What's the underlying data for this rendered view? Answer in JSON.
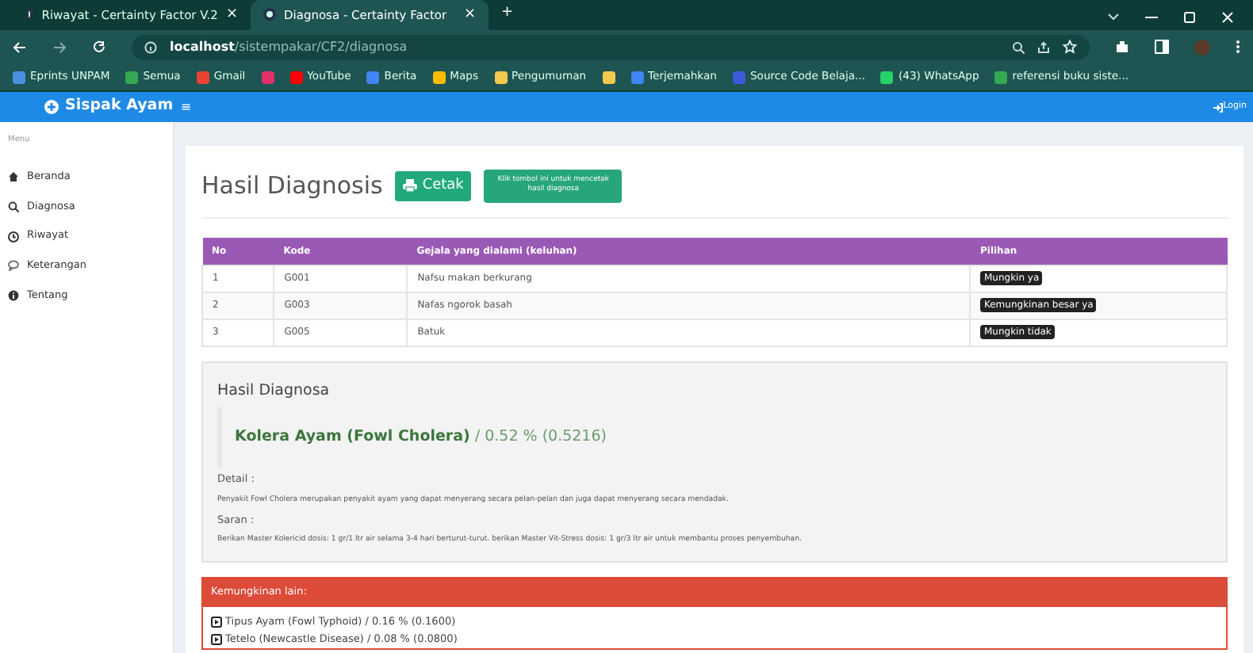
{
  "browser": {
    "tabs": [
      {
        "title": "Riwayat - Certainty Factor V.2",
        "close": "×",
        "selected": false
      },
      {
        "title": "Diagnosa - Certainty Factor",
        "close": "×",
        "selected": true
      }
    ],
    "new_tab": "+",
    "address": {
      "host": "localhost",
      "path": "/sistempakar/CF2/diagnosa"
    },
    "bookmarks": [
      {
        "label": "Eprints UNPAM",
        "color": "#4a90e2"
      },
      {
        "label": "Semua",
        "color": "#34a853"
      },
      {
        "label": "Gmail",
        "color": "#ea4335"
      },
      {
        "color": "#e1306c"
      },
      {
        "label": "YouTube",
        "color": "#ff0000"
      },
      {
        "label": "Berita",
        "color": "#4285f4"
      },
      {
        "label": "Maps",
        "color": "#fbbc04"
      },
      {
        "label": "Pengumuman",
        "color": "#f2c94c"
      },
      {
        "color": "#f2c94c"
      },
      {
        "label": "Terjemahkan",
        "color": "#4285f4"
      },
      {
        "label": "Source Code Belaja...",
        "color": "#3b5bdb"
      },
      {
        "label": "(43) WhatsApp",
        "color": "#25d366"
      },
      {
        "label": "referensi buku siste...",
        "color": "#34a853"
      }
    ]
  },
  "app": {
    "brand": "Sispak Ayam",
    "menu_button": "≡",
    "login": "Login"
  },
  "sidebar": {
    "menu_label": "Menu",
    "items": [
      {
        "label": "Beranda",
        "kind": "home"
      },
      {
        "label": "Diagnosa",
        "kind": "search"
      },
      {
        "label": "Riwayat",
        "kind": "clock"
      },
      {
        "label": "Keterangan",
        "kind": "chat"
      },
      {
        "label": "Tentang",
        "kind": "info"
      }
    ]
  },
  "page": {
    "title": "Hasil Diagnosis",
    "print_button": "Cetak",
    "tooltip": "Klik tombol ini untuk mencetak hasil diagnosa"
  },
  "table": {
    "columns": [
      "No",
      "Kode",
      "Gejala yang dialami (keluhan)",
      "Pilihan"
    ],
    "rows": [
      [
        "1",
        "G001",
        "Nafsu makan berkurang",
        "Mungkin ya"
      ],
      [
        "2",
        "G003",
        "Nafas ngorok basah",
        "Kemungkinan besar ya"
      ],
      [
        "3",
        "G005",
        "Batuk",
        "Mungkin tidak"
      ]
    ]
  },
  "result": {
    "heading": "Hasil Diagnosa",
    "disease": "Kolera Ayam (Fowl Cholera)",
    "score": " / 0.52 % (0.5216)",
    "detail_label": "Detail :",
    "detail": "Penyakit Fowl Cholera merupakan penyakit ayam yang dapat menyerang secara pelan-pelan dan juga dapat menyerang secara mendadak.",
    "advice_label": "Saran :",
    "advice": "Berikan Master Kolericid dosis: 1 gr/1 ltr air selama 3-4 hari berturut-turut. berikan Master Vit-Stress dosis: 1 gr/3 ltr air untuk membantu proses penyembuhan."
  },
  "others": {
    "header": "Kemungkinan lain:",
    "items": [
      "Tipus Ayam (Fowl Typhoid) / 0.16 % (0.1600)",
      "Tetelo (Newcastle Disease) / 0.08 % (0.0800)"
    ]
  }
}
